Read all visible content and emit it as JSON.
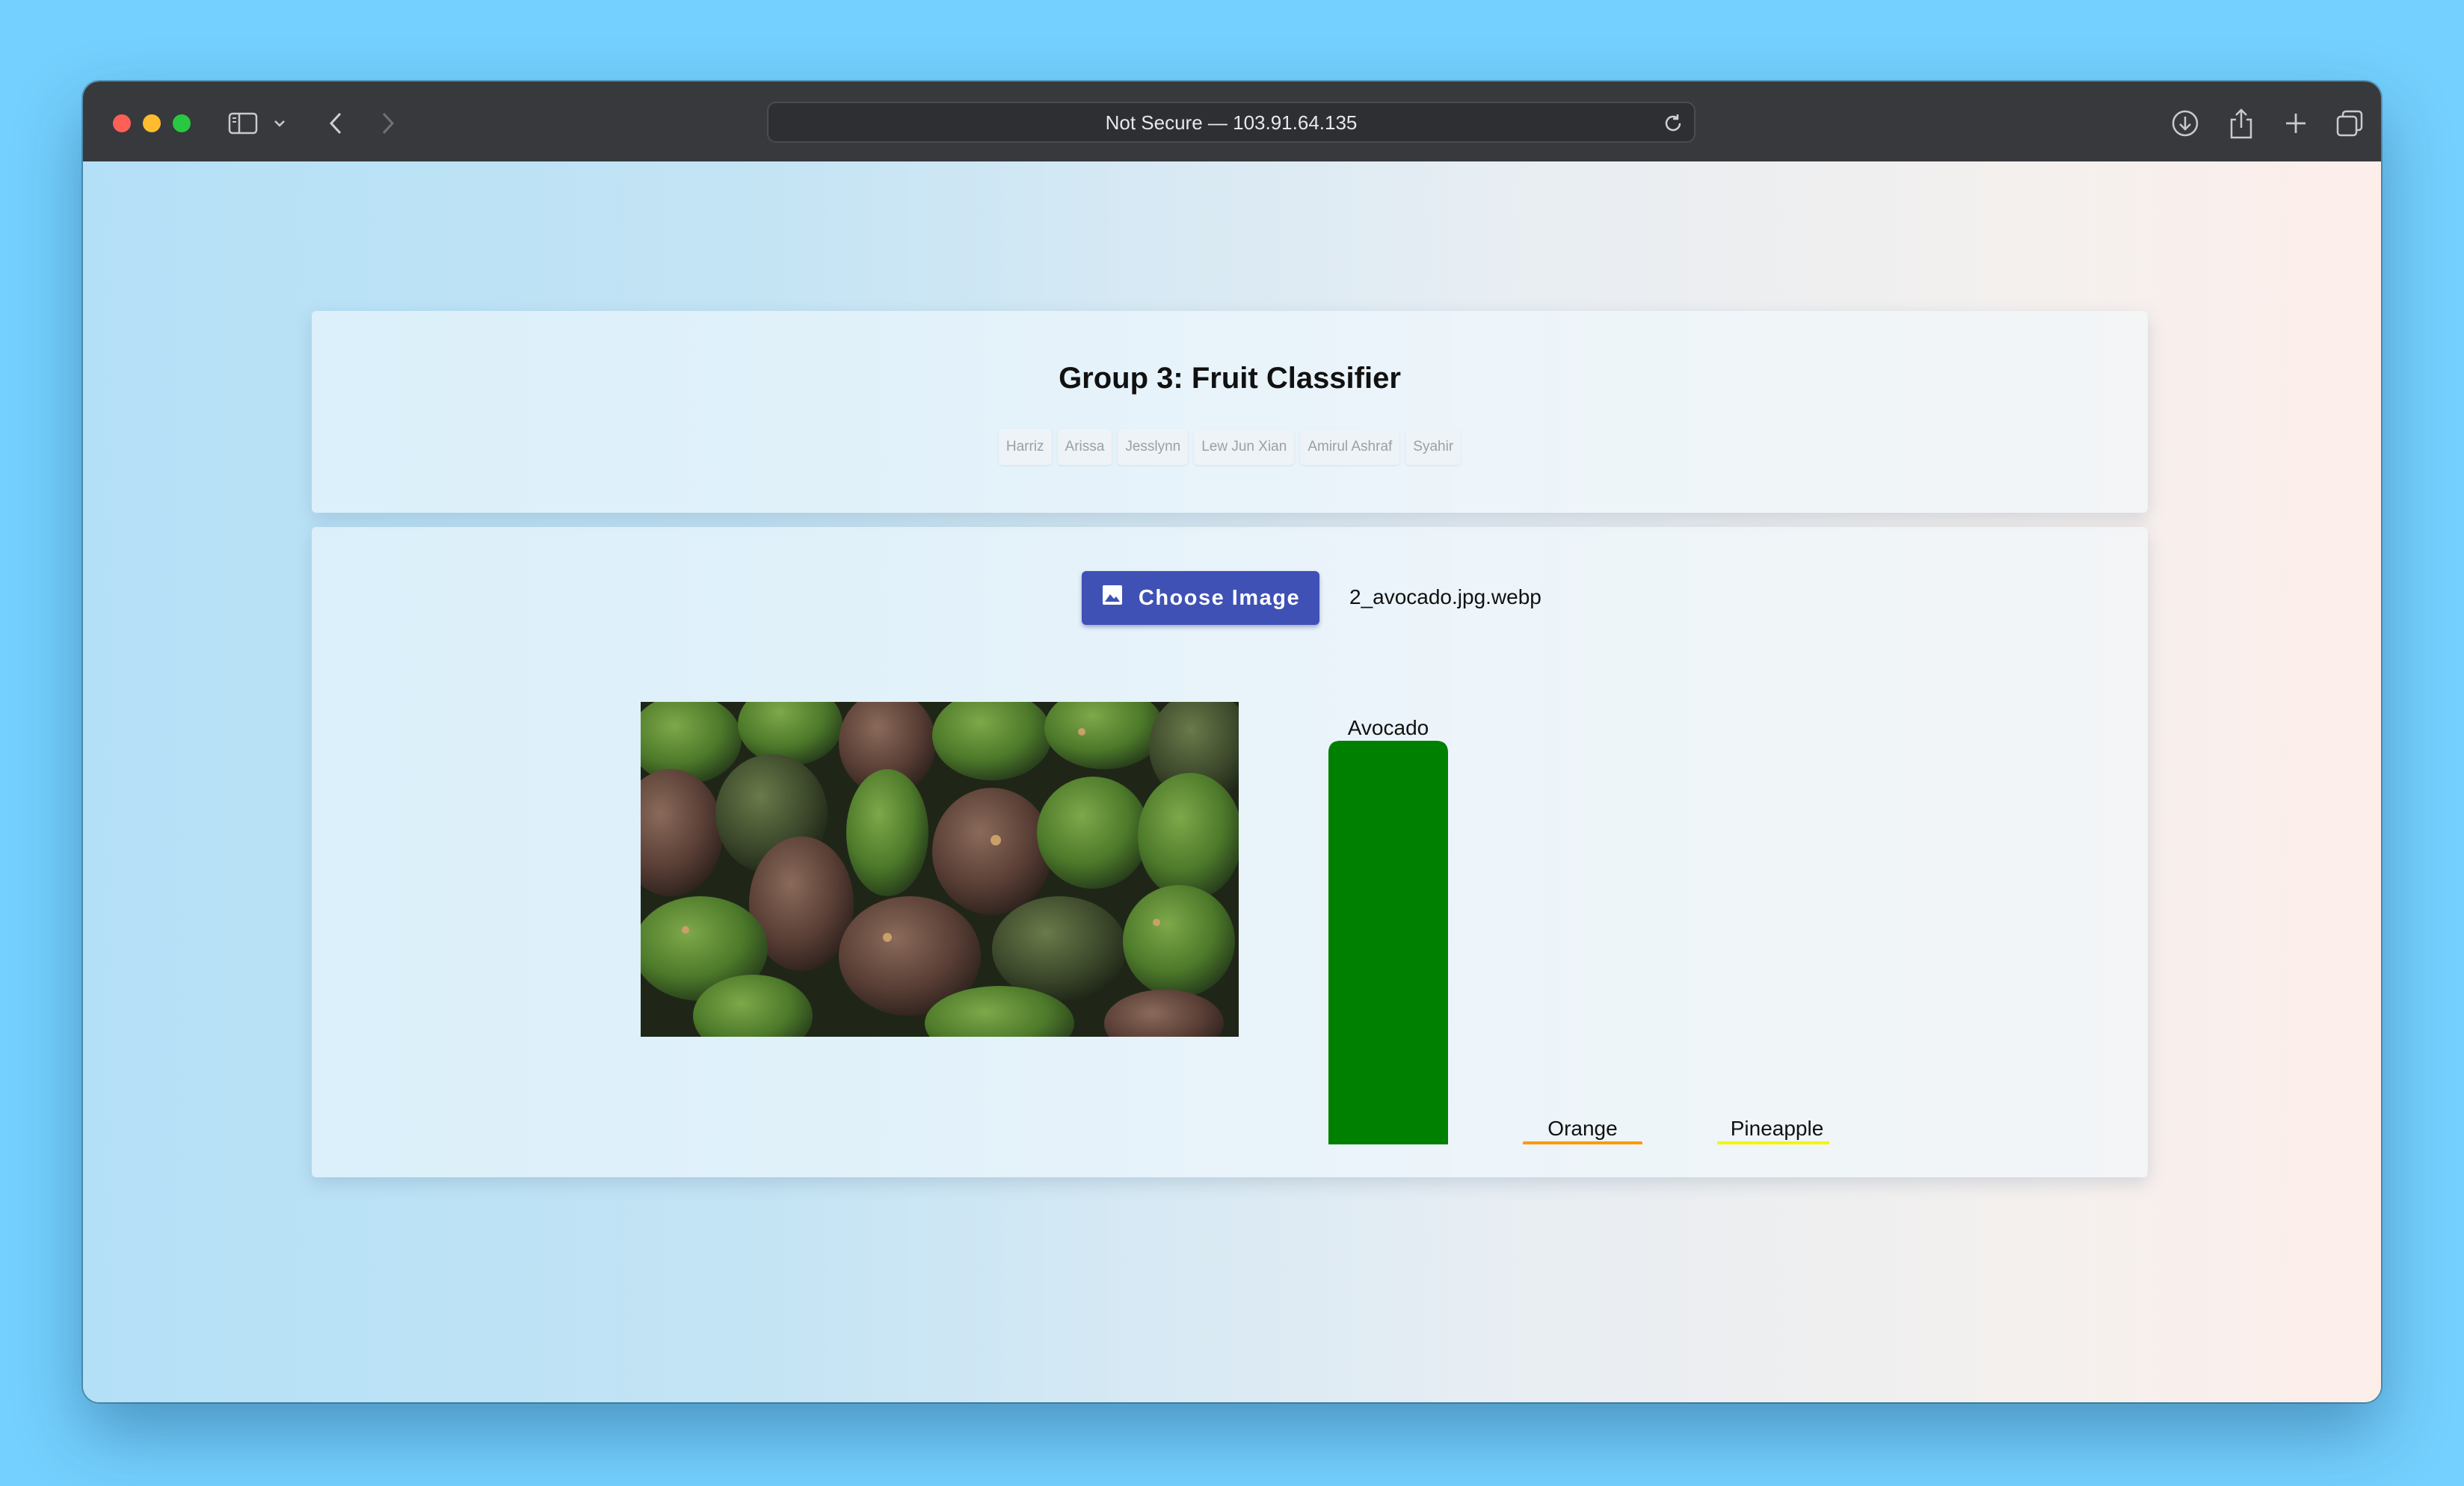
{
  "browser": {
    "url": "Not Secure — 103.91.64.135"
  },
  "header": {
    "title": "Group 3: Fruit Classifier",
    "members": [
      "Harriz",
      "Arissa",
      "Jesslynn",
      "Lew Jun Xian",
      "Amirul Ashraf",
      "Syahir"
    ]
  },
  "upload": {
    "button_label": "Choose Image",
    "filename": "2_avocado.jpg.webp"
  },
  "colors": {
    "button": "#3f51b5",
    "avocado": "#008000",
    "orange": "#ff9800",
    "pineapple": "#f5f500"
  },
  "chart_data": {
    "type": "bar",
    "categories": [
      "Avocado",
      "Orange",
      "Pineapple"
    ],
    "values": [
      1.0,
      0.0,
      0.0
    ],
    "colors": [
      "#008000",
      "#ff9800",
      "#f5f500"
    ],
    "ylim": [
      0,
      1
    ]
  }
}
